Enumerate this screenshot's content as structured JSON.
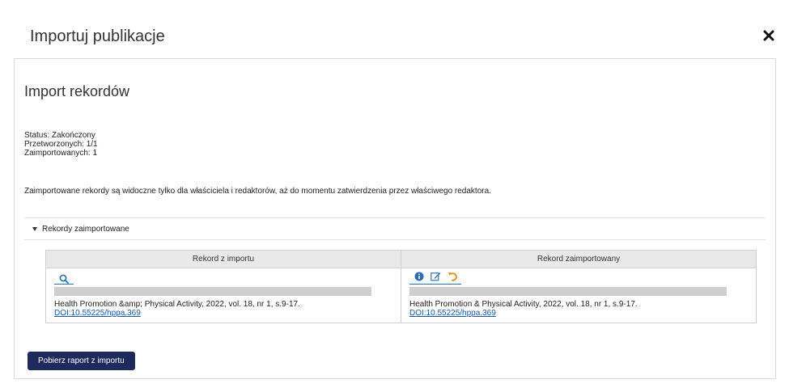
{
  "modal": {
    "title": "Importuj publikacje"
  },
  "panel": {
    "heading": "Import rekordów",
    "status": "Status: Zakończony",
    "processed": "Przetworzonych: 1/1",
    "imported": "Zaimportowanych: 1",
    "notice": "Zaimportowane rekordy są widoczne tylko dla właściciela i redaktorów, aż do momentu zatwierdzenia przez właściwego redaktora.",
    "section_toggle": "Rekordy zaimportowane"
  },
  "table": {
    "headers": [
      "Rekord z importu",
      "Rekord zaimportowany"
    ],
    "import_record": {
      "desc": "Health Promotion &amp; Physical Activity, 2022, vol. 18, nr 1, s.9-17.",
      "doi": "DOI:10.55225/hppa.369"
    },
    "imported_record": {
      "desc": "Health Promotion & Physical Activity, 2022, vol. 18, nr 1, s.9-17.",
      "doi": "DOI:10.55225/hppa.369"
    }
  },
  "report_button": "Pobierz raport z importu",
  "colors": {
    "button": "#1f2a5c",
    "link": "#1a56a8",
    "info_icon": "#2a6db5",
    "undo_icon": "#e0901e"
  }
}
